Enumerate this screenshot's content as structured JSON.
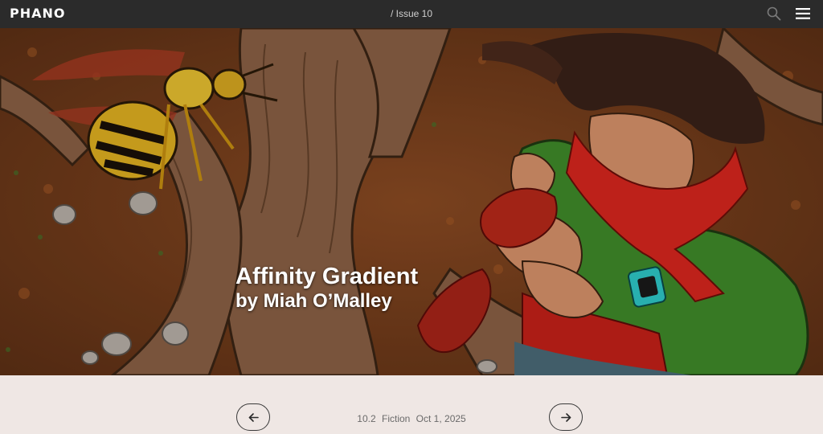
{
  "header": {
    "logo": "PHANO",
    "breadcrumb": "/ Issue 10"
  },
  "hero": {
    "title": "Affinity Gradient",
    "byline": "by Miah O’Malley"
  },
  "pager": {
    "number": "10.2",
    "category": "Fiction",
    "date": "Oct 1, 2025"
  },
  "colors": {
    "topbar": "#2b2b2b",
    "page_bg": "#efe7e4",
    "hero_text": "#ffffff"
  },
  "icons": {
    "search": "search-icon",
    "menu": "hamburger-menu-icon",
    "prev": "arrow-left-icon",
    "next": "arrow-right-icon"
  }
}
